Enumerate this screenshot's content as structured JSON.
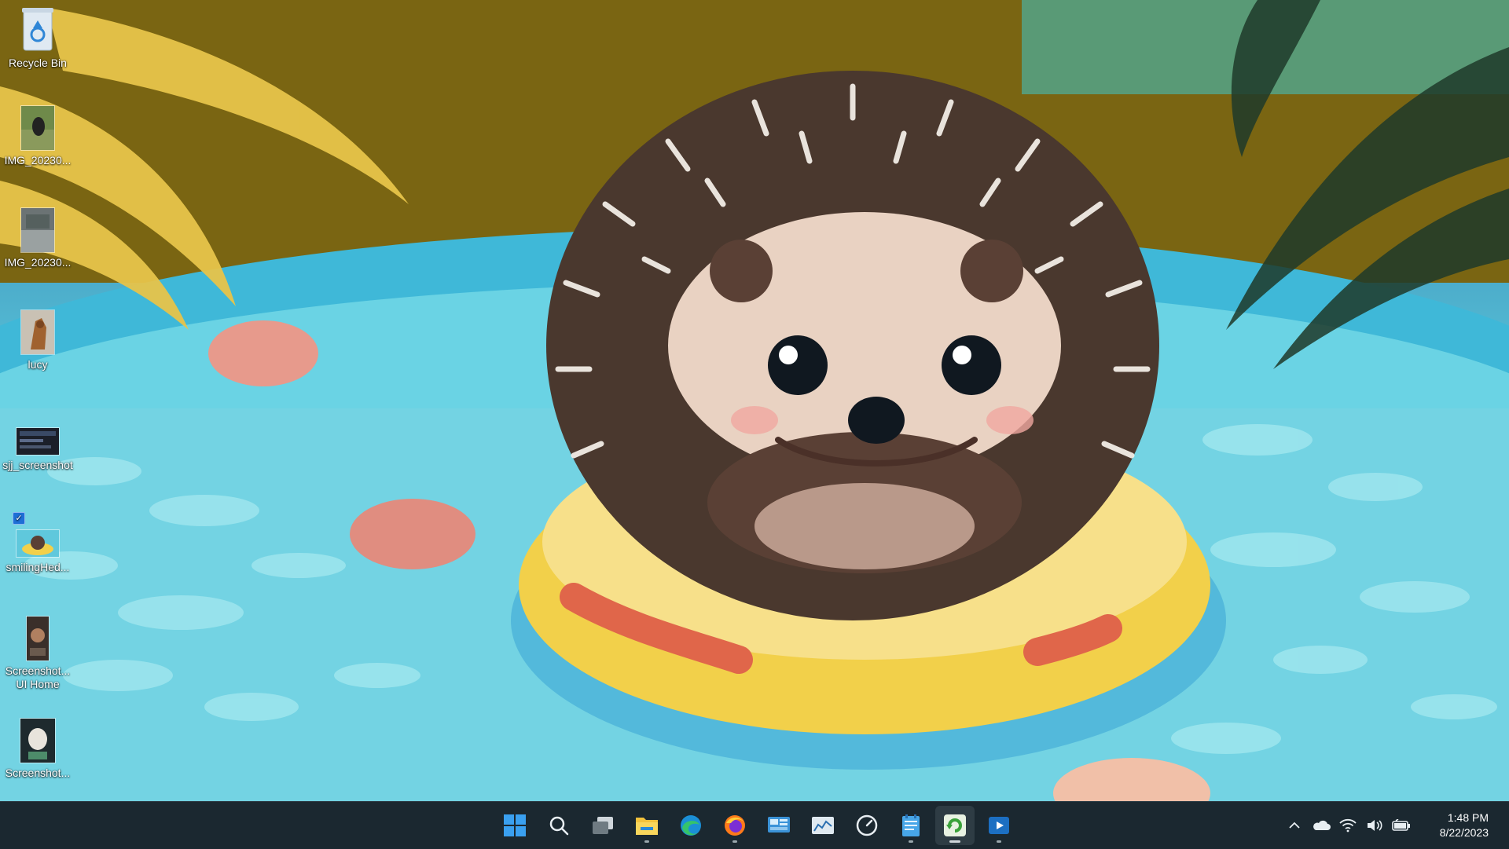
{
  "desktop": {
    "icons": [
      {
        "label": "Recycle Bin",
        "icon": "recycle-bin-icon"
      },
      {
        "label": "IMG_20230...",
        "icon": "image-thumbnail-icon"
      },
      {
        "label": "IMG_20230...",
        "icon": "image-thumbnail-icon"
      },
      {
        "label": "lucy",
        "icon": "image-thumbnail-icon"
      },
      {
        "label": "sjj_screenshot",
        "icon": "image-thumbnail-icon"
      },
      {
        "label": "smilingHed...",
        "icon": "image-thumbnail-icon"
      },
      {
        "label_line1": "Screenshot...",
        "label_line2": "UI Home",
        "icon": "image-thumbnail-icon"
      },
      {
        "label": "Screenshot...",
        "icon": "image-thumbnail-icon"
      }
    ]
  },
  "taskbar": {
    "apps": [
      {
        "name": "start",
        "icon": "windows-start-icon"
      },
      {
        "name": "search",
        "icon": "search-icon"
      },
      {
        "name": "task-view",
        "icon": "task-view-icon"
      },
      {
        "name": "file-explorer",
        "icon": "folder-icon"
      },
      {
        "name": "edge",
        "icon": "edge-browser-icon"
      },
      {
        "name": "firefox",
        "icon": "firefox-icon"
      },
      {
        "name": "app-1",
        "icon": "control-panel-icon"
      },
      {
        "name": "app-2",
        "icon": "chart-app-icon"
      },
      {
        "name": "app-3",
        "icon": "speedometer-icon"
      },
      {
        "name": "notepad",
        "icon": "notepad-icon"
      },
      {
        "name": "app-4",
        "icon": "green-refresh-icon"
      },
      {
        "name": "media-player",
        "icon": "media-player-icon"
      }
    ],
    "tray": {
      "icons": [
        "chevron-up-icon",
        "onedrive-cloud-icon",
        "wifi-icon",
        "volume-icon",
        "battery-icon"
      ],
      "time": "1:48 PM",
      "date": "8/22/2023"
    }
  },
  "colors": {
    "taskbar_bg": "#1b2830",
    "accent_blue": "#1e90ff"
  }
}
